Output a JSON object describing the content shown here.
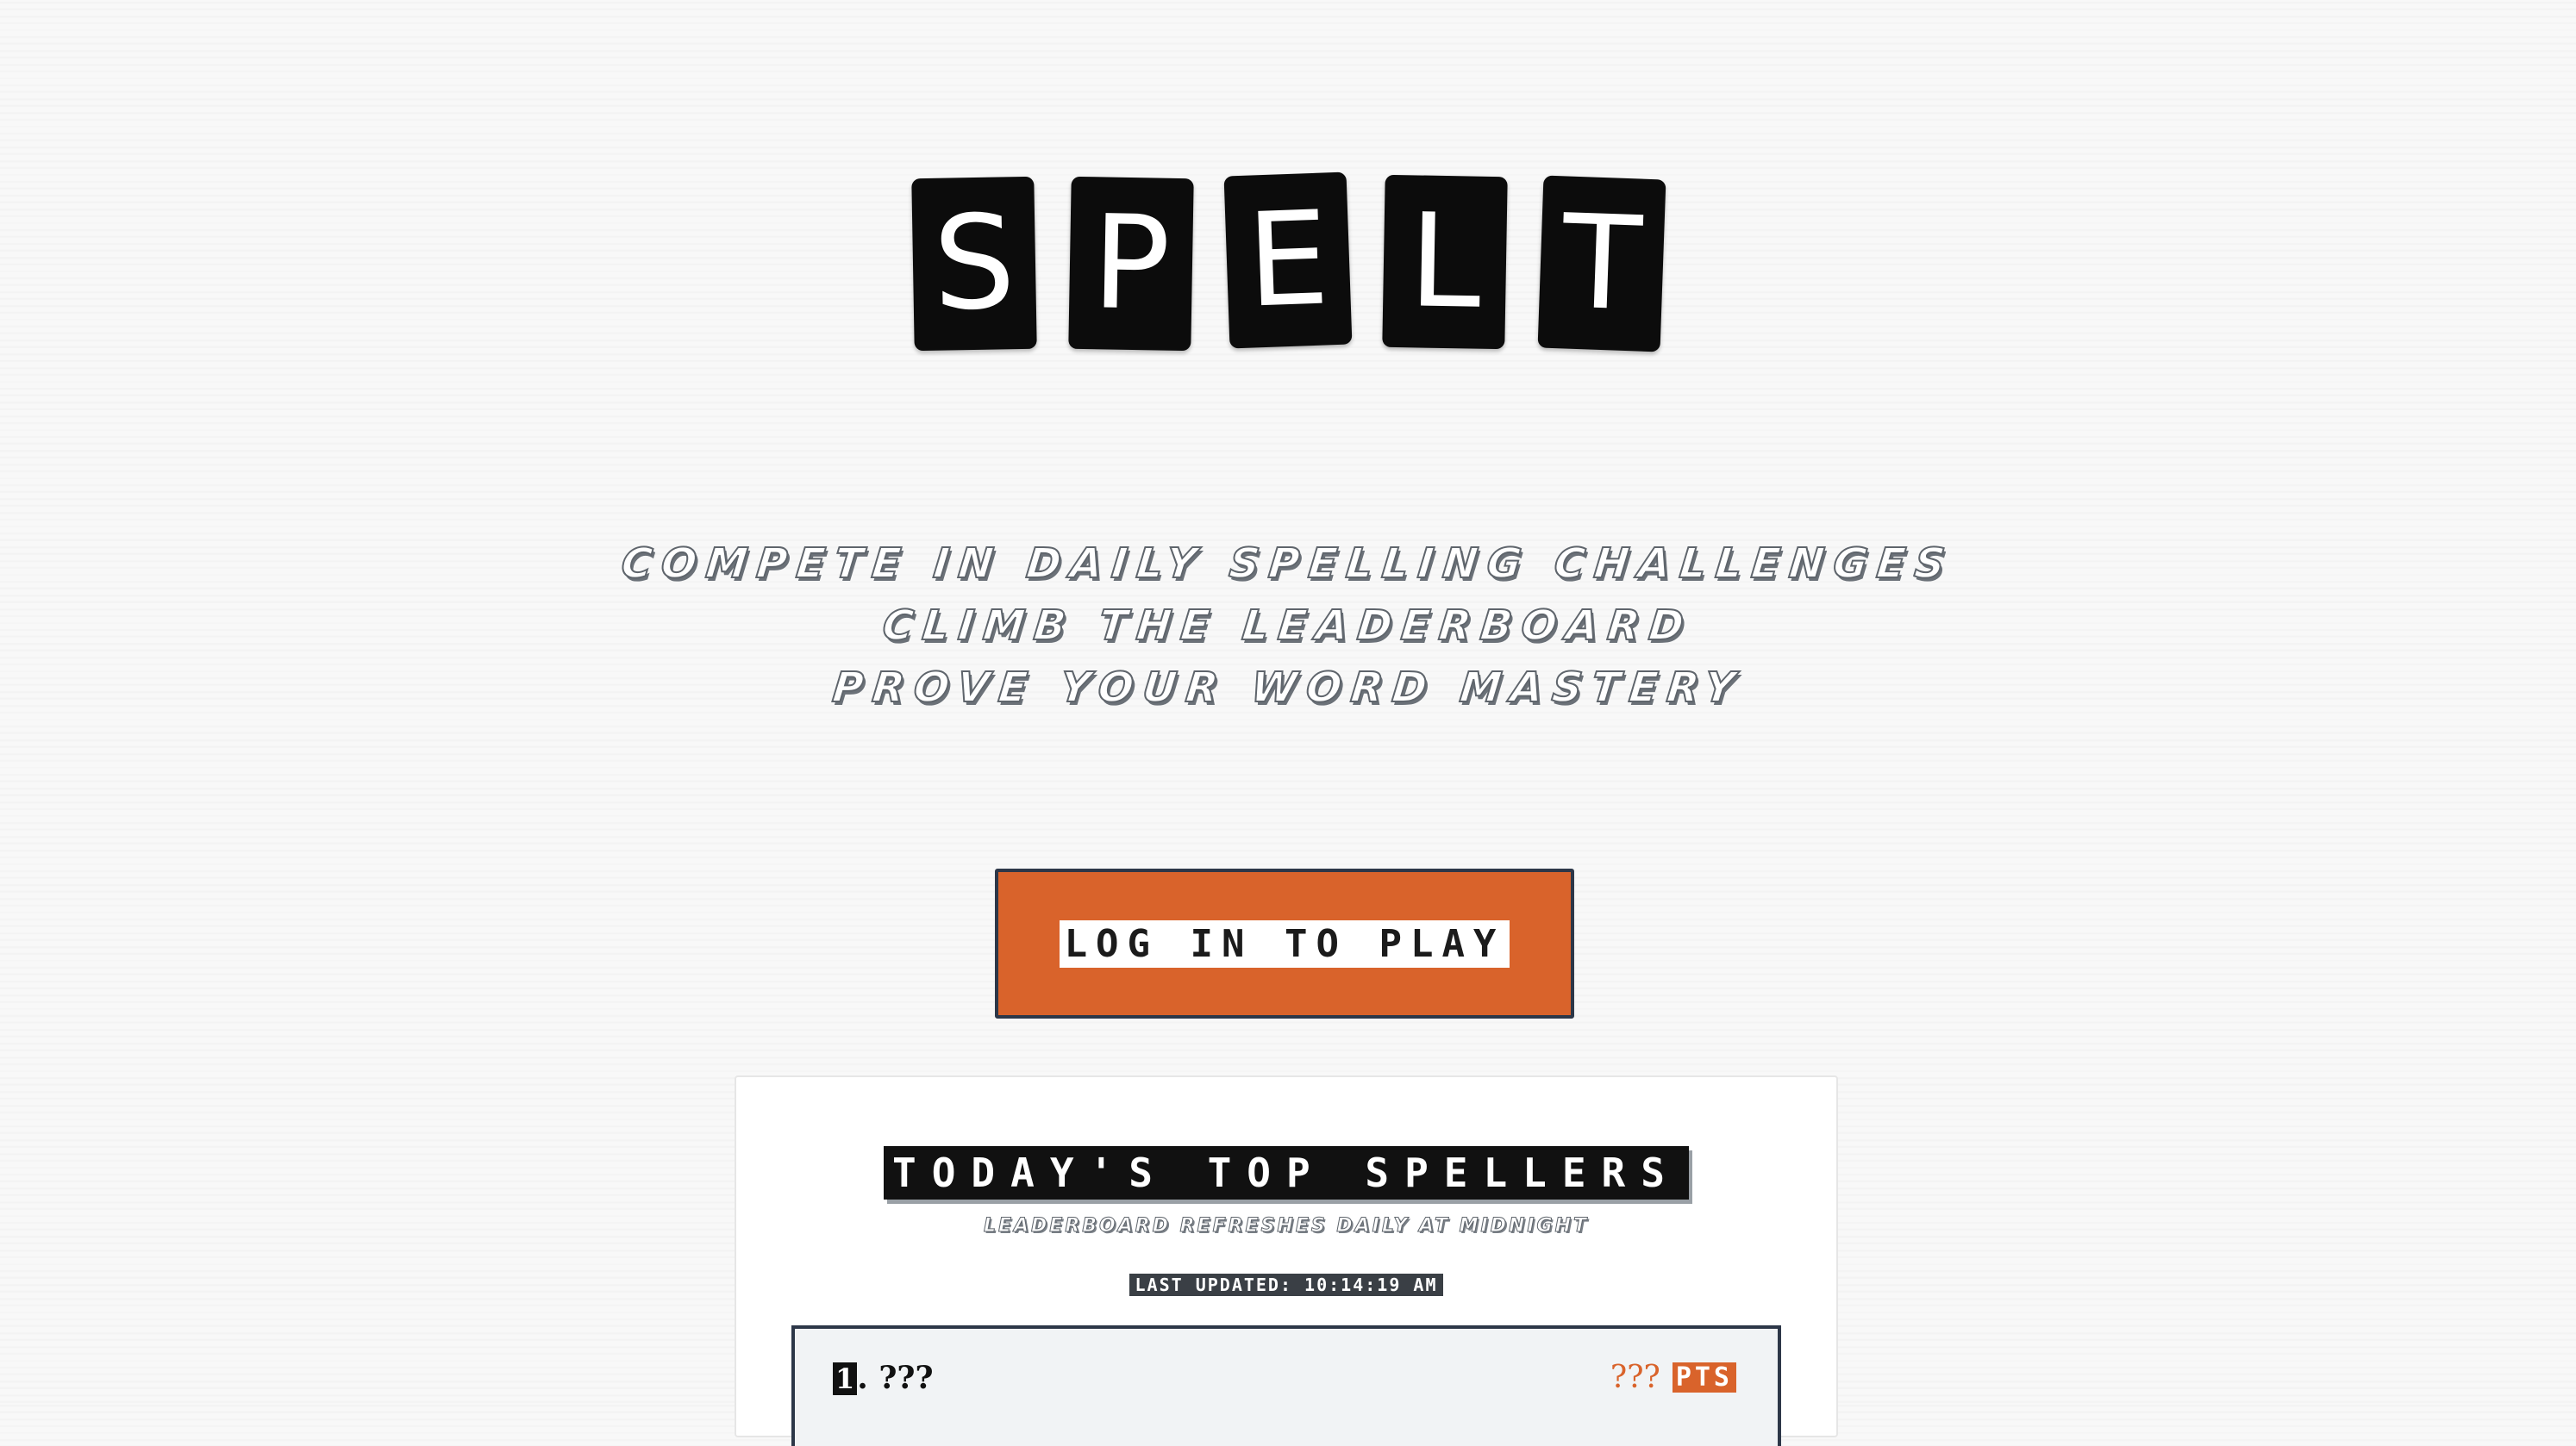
{
  "logo": {
    "letters": [
      "S",
      "P",
      "E",
      "L",
      "T"
    ]
  },
  "tagline": {
    "lines": [
      "Compete in daily spelling challenges",
      "Climb the leaderboard",
      "Prove your word mastery"
    ]
  },
  "cta": {
    "label": "Log in to play"
  },
  "leaderboard": {
    "title": "Today's Top Spellers",
    "subtitle": "Leaderboard refreshes daily at midnight",
    "last_updated": "Last updated: 10:14:19 AM",
    "rows": [
      {
        "rank": "1",
        "rank_suffix": ". ???",
        "score": "???",
        "unit": "PTS"
      }
    ]
  },
  "colors": {
    "accent": "#d9632b",
    "dark": "#2d3748",
    "tile": "#0c0c0c"
  }
}
